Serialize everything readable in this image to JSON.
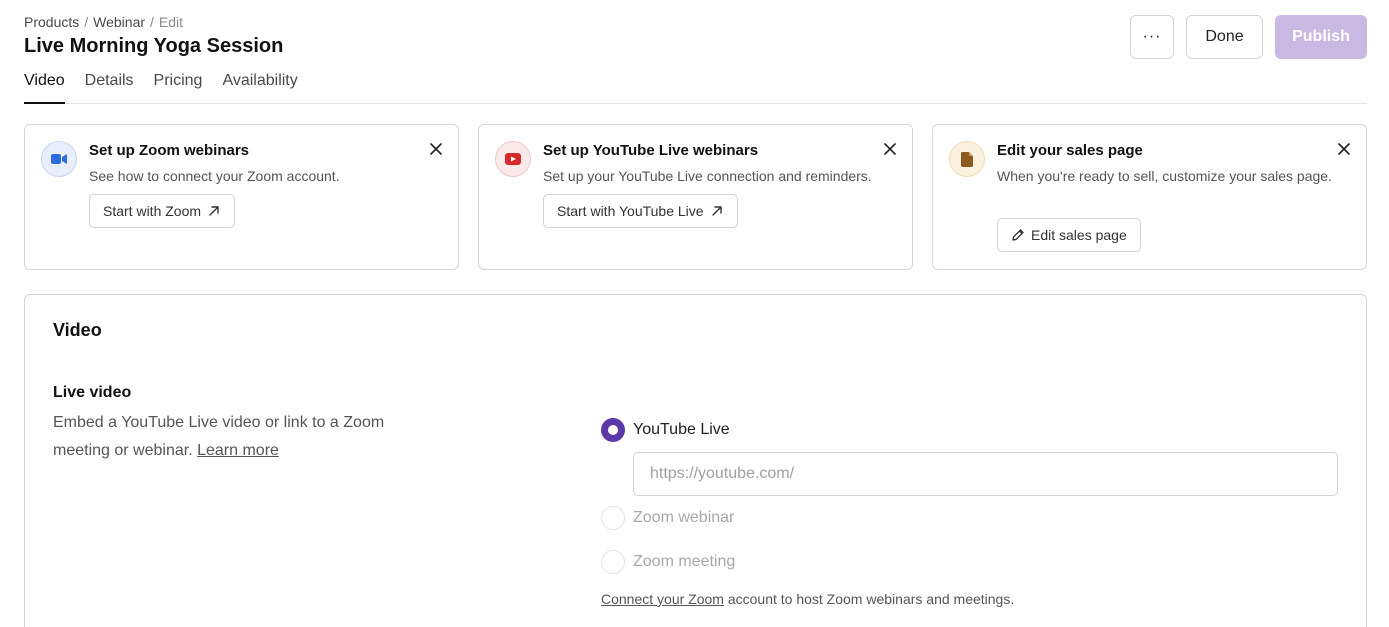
{
  "breadcrumb": {
    "products": "Products",
    "webinar": "Webinar",
    "edit": "Edit",
    "sep": "/"
  },
  "page_title": "Live Morning Yoga Session",
  "tabs": [
    {
      "label": "Video",
      "active": true
    },
    {
      "label": "Details"
    },
    {
      "label": "Pricing"
    },
    {
      "label": "Availability"
    }
  ],
  "actions": {
    "more_label": "···",
    "done_label": "Done",
    "publish_label": "Publish"
  },
  "cards": [
    {
      "icon": "zoom-camera-icon",
      "title": "Set up Zoom webinars",
      "description": "See how to connect your Zoom account.",
      "button_label": "Start with Zoom",
      "button_icon": "external-arrow-icon"
    },
    {
      "icon": "youtube-play-icon",
      "title": "Set up YouTube Live webinars",
      "description": "Set up your YouTube Live connection and reminders.",
      "button_label": "Start with YouTube Live",
      "button_icon": "external-arrow-icon"
    },
    {
      "icon": "document-icon",
      "title": "Edit your sales page",
      "description": "When you're ready to sell, customize your sales page.",
      "button_label": "Edit sales page",
      "button_icon": "pencil-icon"
    }
  ],
  "video_section": {
    "title": "Video",
    "field_label": "Live video",
    "field_description": "Embed a YouTube Live video or link to a Zoom meeting or webinar.",
    "learn_more_label": "Learn more",
    "options": [
      {
        "label": "YouTube Live",
        "selected": true
      },
      {
        "label": "Zoom webinar",
        "selected": false
      },
      {
        "label": "Zoom meeting",
        "selected": false
      }
    ],
    "url_placeholder": "https://youtube.com/",
    "connect_link_label": "Connect your Zoom",
    "connect_note": "account to host Zoom webinars and meetings."
  },
  "colors": {
    "accent": "#5b3aa8",
    "publish_disabled": "#c9b8e2",
    "zoom_blue": "#2d6cdf",
    "youtube_red": "#d62a2a",
    "sales_brown": "#8a5a1e"
  }
}
